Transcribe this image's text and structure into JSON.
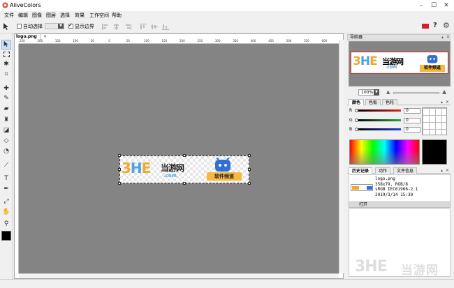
{
  "app": {
    "title": "AliveColors"
  },
  "menu": [
    "文件",
    "编辑",
    "图像",
    "图层",
    "选择",
    "效果",
    "工作空间",
    "帮助"
  ],
  "toolbar": {
    "auto_select_label": "自动选择",
    "auto_select_checked": false,
    "show_bounds_label": "显示边界",
    "show_bounds_checked": true
  },
  "document": {
    "tab_title": "logo.png",
    "ruler_labels": [
      "250",
      "200",
      "150",
      "100",
      "50",
      "0",
      "50",
      "100",
      "150",
      "200",
      "250",
      "300",
      "350",
      "400",
      "450",
      "500",
      "550",
      "600"
    ]
  },
  "logo": {
    "brand_mark": "3HE",
    "brand_text": "当游网",
    "domain_text": ".com",
    "ribbon_text": "软件频道"
  },
  "panels": {
    "navigator": {
      "title": "导航器",
      "zoom_value": "100%"
    },
    "color": {
      "tabs": [
        "颜色",
        "色板",
        "色轮"
      ],
      "active_tab": "颜色",
      "channels": [
        {
          "label": "R",
          "value": "0",
          "color": "#e0241b"
        },
        {
          "label": "G",
          "value": "0",
          "color": "#22a63a"
        },
        {
          "label": "B",
          "value": "0",
          "color": "#1f3fd9"
        }
      ],
      "current_color": "#000000"
    },
    "history": {
      "tabs": [
        "历史记录",
        "动作",
        "文件信息"
      ],
      "active_tab": "历史记录",
      "file_info": [
        "logo.png",
        "358x79, RGB/8",
        "sRGB IEC61966-2.1",
        "2019/3/14 15:30"
      ],
      "entries": [
        "打开"
      ]
    }
  },
  "watermark": {
    "mark": "3HE",
    "text": "当游网"
  }
}
